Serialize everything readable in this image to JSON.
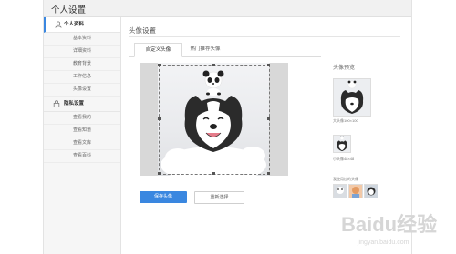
{
  "page": {
    "title": "个人设置"
  },
  "sidebar": {
    "sections": [
      {
        "label": "个人资料",
        "icon": "user-icon",
        "items": [
          "基本资料",
          "详细资料",
          "教育背景",
          "工作信息",
          "头像设置"
        ]
      },
      {
        "label": "隐私设置",
        "icon": "lock-icon",
        "items": [
          "查看我的",
          "查看知道",
          "查看文库",
          "查看百科"
        ]
      }
    ]
  },
  "main": {
    "title": "头像设置",
    "tabs": [
      {
        "label": "自定义头像",
        "active": true
      },
      {
        "label": "热门推荐头像",
        "active": false
      }
    ],
    "save_button": "保存头像",
    "reselect_button": "重新选择",
    "accent_color": "#3a87e0"
  },
  "preview": {
    "title": "头像预览",
    "large_caption": "大头像100×100",
    "small_caption": "小头像48×48",
    "recent_caption": "我使用过的头像"
  },
  "watermark": {
    "text": "Baidu经验",
    "url_text": "jingyan.baidu.com"
  }
}
